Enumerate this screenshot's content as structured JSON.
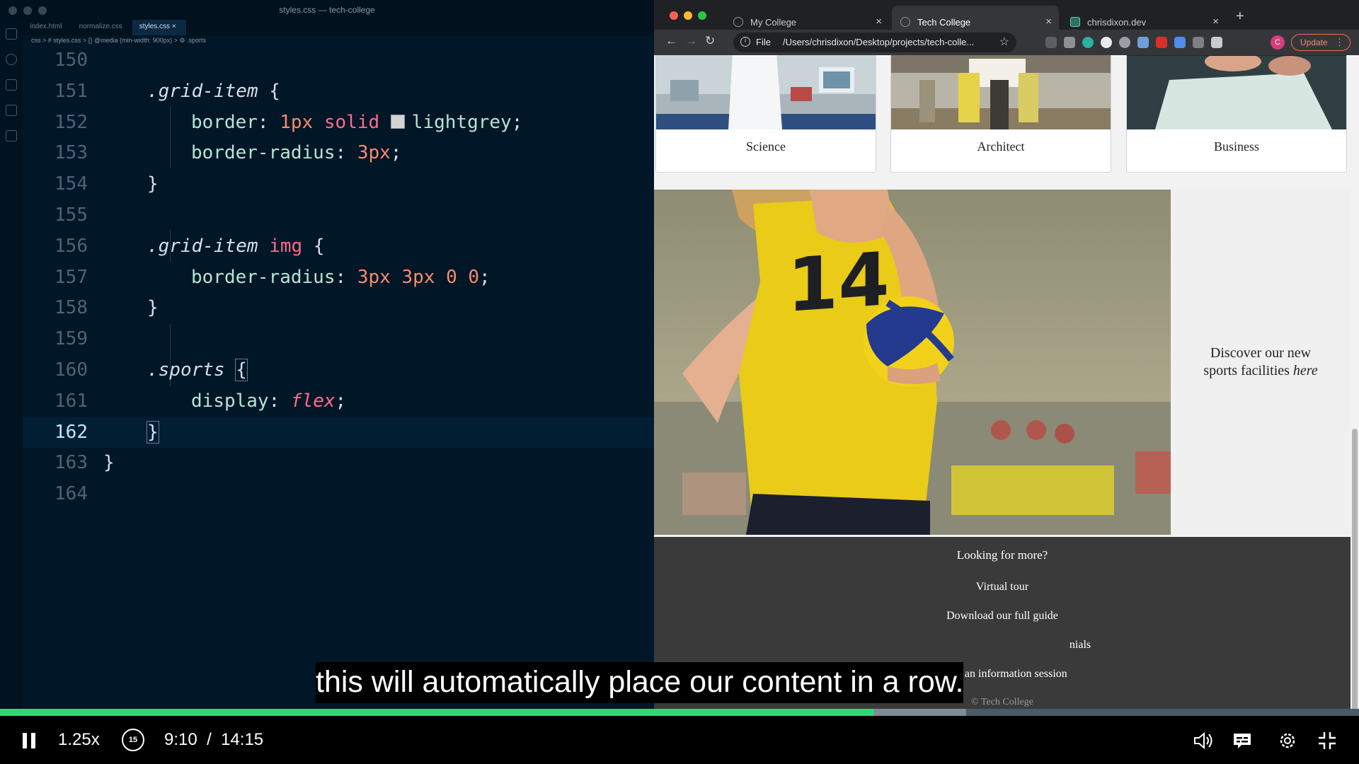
{
  "editor": {
    "window_title": "styles.css — tech-college",
    "tabs": [
      "index.html",
      "normalize.css",
      "styles.css"
    ],
    "breadcrumb": "css > # styles.css > {} @media (min-width: 900px) > ⚙ .sports",
    "lines": [
      {
        "num": "150"
      },
      {
        "num": "151",
        "sel": ".grid-item",
        "rest": " {"
      },
      {
        "num": "152",
        "prop": "border",
        "n1": "1px",
        "k1": "solid",
        "v1": "lightgrey",
        "end": ";"
      },
      {
        "num": "153",
        "prop": "border-radius",
        "n1": "3px",
        "end": ";"
      },
      {
        "num": "154",
        "brace": "}"
      },
      {
        "num": "155"
      },
      {
        "num": "156",
        "sel": ".grid-item",
        "tag": "img",
        "rest": " {"
      },
      {
        "num": "157",
        "prop": "border-radius",
        "n1": "3px",
        "n2": "3px",
        "n3": "0",
        "n4": "0",
        "end": ";"
      },
      {
        "num": "158",
        "brace": "}"
      },
      {
        "num": "159"
      },
      {
        "num": "160",
        "sel": ".sports",
        "rest": "{"
      },
      {
        "num": "161",
        "prop": "display",
        "v1": "flex",
        "end": ";"
      },
      {
        "num": "162",
        "brace": "}"
      },
      {
        "num": "163",
        "brace": "}"
      },
      {
        "num": "164"
      }
    ]
  },
  "browser": {
    "tabs": [
      {
        "label": "My College"
      },
      {
        "label": "Tech College"
      },
      {
        "label": "chrisdixon.dev"
      }
    ],
    "address_scheme": "File",
    "address_url": "/Users/chrisdixon/Desktop/projects/tech-colle...",
    "update_label": "Update",
    "avatar_letter": "C",
    "grid_items": [
      "Science",
      "Architect",
      "Business"
    ],
    "sports_text_1": "Discover our new",
    "sports_text_2": "sports facilities",
    "sports_text_em": "here",
    "jersey_number": "14",
    "footer": {
      "heading": "Looking for more?",
      "links": [
        "Virtual tour",
        "Download our full guide",
        "nials",
        "Book an information session"
      ],
      "copyright": "© Tech College"
    }
  },
  "player": {
    "speed": "1.25x",
    "rewind_seconds": "15",
    "current_time": "9:10",
    "separator": "/",
    "total_time": "14:15",
    "progress_fraction": 0.643,
    "buffered_fraction": 0.711,
    "caption": "this will automatically place our content in a row."
  },
  "colors": {
    "editor_bg": "#011627",
    "progress_played": "#2fd876",
    "footer_bg": "#3a3a3a"
  }
}
